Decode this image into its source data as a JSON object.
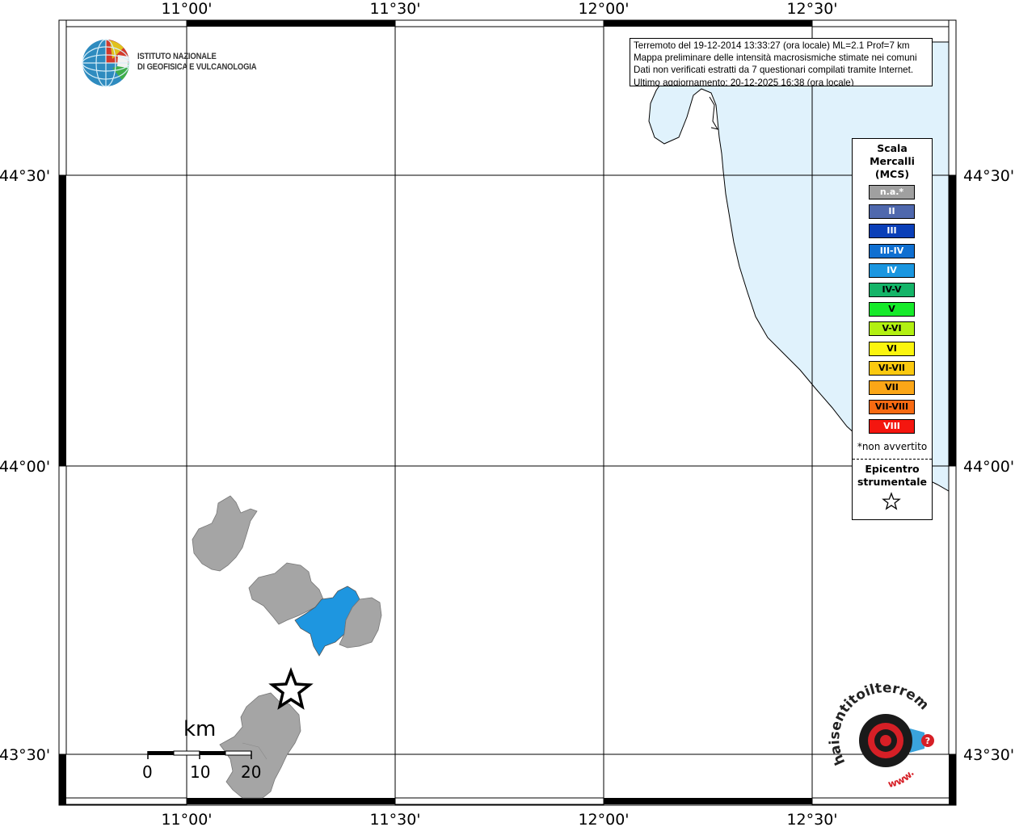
{
  "map": {
    "lon_labels_top": [
      "11°00'",
      "11°30'",
      "12°00'",
      "12°30'"
    ],
    "lon_labels_bottom": [
      "11°00'",
      "11°30'",
      "12°00'",
      "12°30'"
    ],
    "lat_labels_left": [
      "44°30'",
      "44°00'",
      "43°30'"
    ],
    "lat_labels_right": [
      "44°30'",
      "44°00'",
      "43°30'"
    ],
    "colors": {
      "sea": "#e0f2fc",
      "na": "#a5a5a5",
      "intensity_iv": "#1e96e0"
    }
  },
  "info": {
    "line1": "Terremoto del 19-12-2014 13:33:27 (ora locale) ML=2.1 Prof=7 km",
    "line2": "Mappa preliminare delle intensità macrosismiche stimate nei comuni",
    "line3": "Dati non verificati estratti da 7 questionari compilati tramite Internet.",
    "line4": "Ultimo aggiornamento: 20-12-2025 16:38 (ora locale)"
  },
  "logo": {
    "line1": "ISTITUTO NAZIONALE",
    "line2": "DI GEOFISICA E VULCANOLOGIA",
    "icon": "ingv-globe-logo"
  },
  "legend": {
    "title_line1": "Scala",
    "title_line2": "Mercalli",
    "title_line3": "(MCS)",
    "items": [
      {
        "label": "n.a.*",
        "color": "#a0a0a0",
        "text_color": "#ffffff"
      },
      {
        "label": "II",
        "color": "#4f68ad",
        "text_color": "#ffffff"
      },
      {
        "label": "III",
        "color": "#0a3fb8",
        "text_color": "#ffffff"
      },
      {
        "label": "III-IV",
        "color": "#0f6fd1",
        "text_color": "#ffffff"
      },
      {
        "label": "IV",
        "color": "#1a96e0",
        "text_color": "#ffffff"
      },
      {
        "label": "IV-V",
        "color": "#14b468",
        "text_color": "#000000"
      },
      {
        "label": "V",
        "color": "#16ea2a",
        "text_color": "#000000"
      },
      {
        "label": "V-VI",
        "color": "#b2f012",
        "text_color": "#000000"
      },
      {
        "label": "VI",
        "color": "#fbf50e",
        "text_color": "#000000"
      },
      {
        "label": "VI-VII",
        "color": "#fbc90f",
        "text_color": "#000000"
      },
      {
        "label": "VII",
        "color": "#fba617",
        "text_color": "#000000"
      },
      {
        "label": "VII-VIII",
        "color": "#f86a12",
        "text_color": "#000000"
      },
      {
        "label": "VIII",
        "color": "#f4160f",
        "text_color": "#ffffff"
      }
    ],
    "note": "*non avvertito",
    "epicenter_line1": "Epicentro",
    "epicenter_line2": "strumentale",
    "epicenter_icon": "star-icon"
  },
  "scale_bar": {
    "unit": "km",
    "ticks": [
      "0",
      "10",
      "20"
    ]
  },
  "hsit_logo": {
    "text_arc": "haisentitoilterremoto.it",
    "text_arc_bottom": "www.",
    "icon": "hsit-target-logo"
  }
}
